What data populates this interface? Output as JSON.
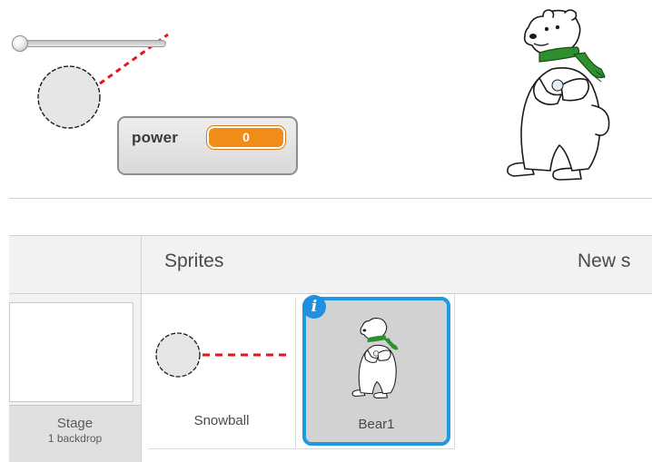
{
  "stage": {
    "monitor": {
      "label": "power",
      "value": "0",
      "slider_fraction": 0
    }
  },
  "sprite_pane": {
    "title": "Sprites",
    "new_sprite_label": "New s",
    "stage_thumb": {
      "name": "Stage",
      "subtitle": "1 backdrop"
    },
    "sprites": [
      {
        "name": "Snowball",
        "selected": false
      },
      {
        "name": "Bear1",
        "selected": true,
        "badge_icon": "info-icon"
      }
    ]
  },
  "colors": {
    "selection_blue": "#1f9ae0",
    "monitor_orange": "#f08c18",
    "aim_line_red": "#e8141e",
    "scarf_green": "#2f8f2f"
  }
}
